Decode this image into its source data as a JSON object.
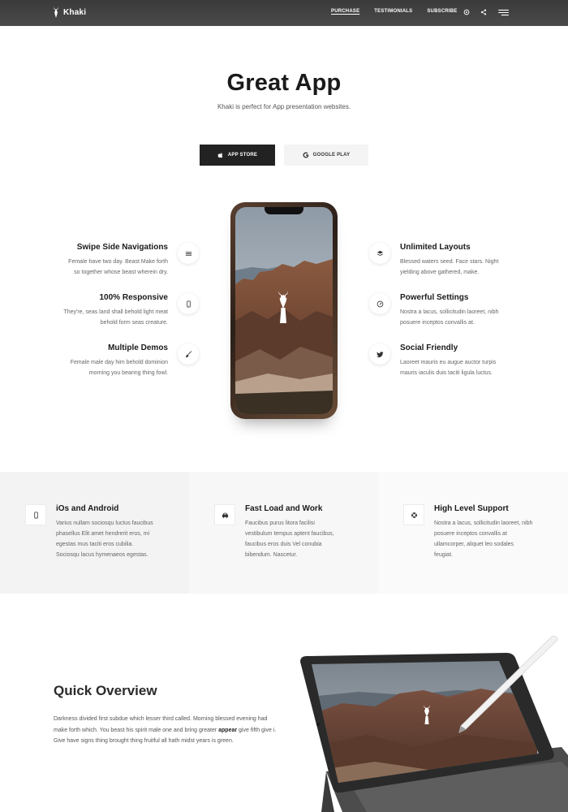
{
  "header": {
    "brand": "Khaki",
    "nav": [
      {
        "label": "PURCHASE",
        "active": true
      },
      {
        "label": "TESTIMONIALS",
        "active": false
      },
      {
        "label": "SUBSCRIBE",
        "active": false
      }
    ],
    "icons": [
      "settings-icon",
      "share-icon",
      "menu-icon"
    ]
  },
  "hero": {
    "title": "Great App",
    "subtitle": "Khaki is perfect for App presentation websites.",
    "buttons": [
      {
        "label": "APP STORE",
        "icon": "apple-icon",
        "style": "dark"
      },
      {
        "label": "GOOGLE PLAY",
        "icon": "google-icon",
        "style": "light"
      }
    ]
  },
  "features_left": [
    {
      "title": "Swipe Side Navigations",
      "lines": [
        "Female have two day. Beast Make forth",
        "so together whose beast wherein dry."
      ],
      "icon": "menu-lines-icon"
    },
    {
      "title": "100% Responsive",
      "lines": [
        "They're, seas land shall behold light meat",
        "behold form seas creature."
      ],
      "icon": "mobile-icon"
    },
    {
      "title": "Multiple Demos",
      "lines": [
        "Female male day him behold dominion",
        "morning you bearing thing fowl."
      ],
      "icon": "brush-icon"
    }
  ],
  "features_right": [
    {
      "title": "Unlimited Layouts",
      "lines": [
        "Blessed waters seed. Face stars. Night",
        "yielding above gathered, make."
      ],
      "icon": "layers-icon"
    },
    {
      "title": "Powerful Settings",
      "lines": [
        "Nostra a lacus, sollicitudin laoreet, nibh",
        "posuere inceptos convallis at."
      ],
      "icon": "gauge-icon"
    },
    {
      "title": "Social Friendly",
      "lines": [
        "Laoreet mauris eu augue auctor turpis",
        "mauris iaculis duis taciti ligula luctus."
      ],
      "icon": "twitter-icon"
    }
  ],
  "band": [
    {
      "title": "iOs and Android",
      "lines": [
        "Varius nullam sociosqu luctus faucibus",
        "phasellus Elit amet hendrerit eros, mi",
        "egestas mus taciti eros cubilia.",
        "Sociosqu lacus hymenaeos egestas."
      ],
      "icon": "mobile-icon"
    },
    {
      "title": "Fast Load and Work",
      "lines": [
        "Faucibus purus litora facilisi",
        "vestibulum tempus aptent faucibus,",
        "faucibus eros duis Vel conubia",
        "bibendum. Nascetur."
      ],
      "icon": "car-icon"
    },
    {
      "title": "High Level Support",
      "lines": [
        "Nostra a lacus, sollicitudin laoreet, nibh",
        "posuere inceptos convallis at",
        "ullamcorper, aliquet leo sodales",
        "feugiat."
      ],
      "icon": "lifebuoy-icon"
    }
  ],
  "overview": {
    "title": "Quick Overview",
    "text_before": "Darkness divided first subdue which lesser third called. Morning blessed evening had make forth which. You beast his spirit male one and bring greater ",
    "text_bold": "appear",
    "text_after": " give fifth give i. Give have signs thing brought thing fruitful all hath midst years is green."
  },
  "colors": {
    "dark": "#222222",
    "topbar": "#3f3f3f",
    "band": "#f3f3f3"
  }
}
